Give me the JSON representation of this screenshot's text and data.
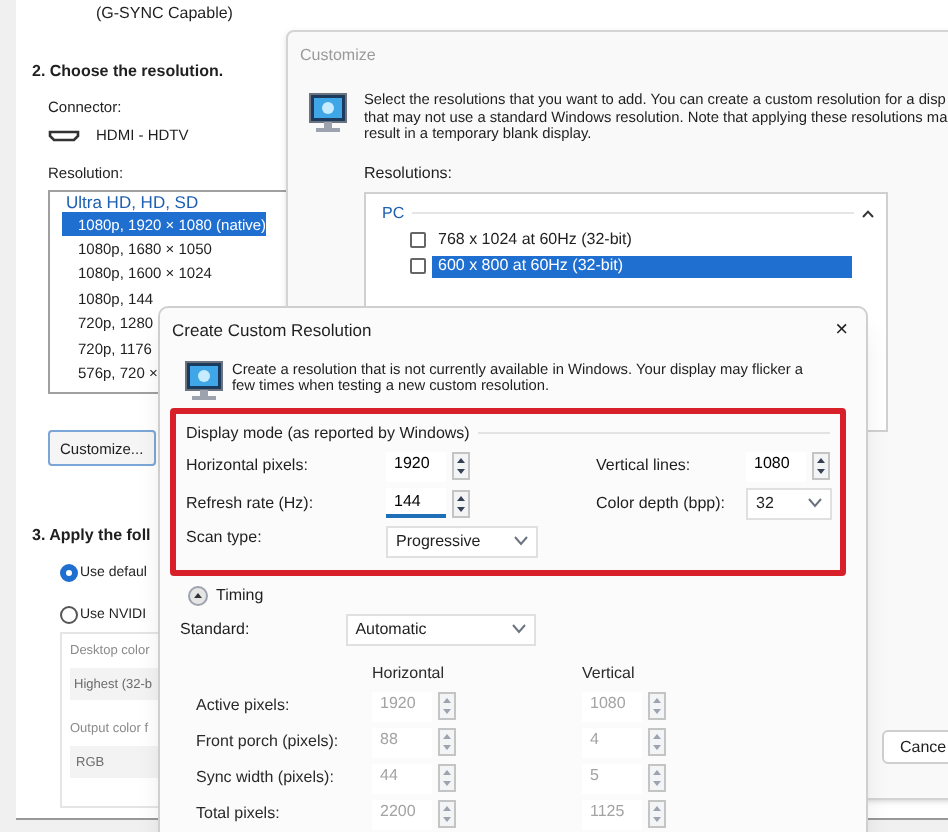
{
  "nvidia_panel": {
    "top_text": "(G-SYNC Capable)",
    "step2": "2. Choose the resolution.",
    "connector_label": "Connector:",
    "connector": "HDMI - HDTV",
    "resolution_label": "Resolution:",
    "resolution_group": "Ultra HD, HD, SD",
    "resolutions": [
      {
        "label": "1080p, 1920 × 1080 (native)",
        "selected": true
      },
      {
        "label": "1080p, 1680 × 1050",
        "selected": false
      },
      {
        "label": "1080p, 1600 × 1024",
        "selected": false
      },
      {
        "label": "1080p, 144",
        "selected": false
      },
      {
        "label": "720p, 1280",
        "selected": false
      },
      {
        "label": "720p, 1176",
        "selected": false
      },
      {
        "label": "576p, 720 ×",
        "selected": false
      }
    ],
    "customize_button": "Customize...",
    "step3": "3. Apply the foll",
    "options": [
      {
        "label": "Use defaul",
        "selected": true
      },
      {
        "label": "Use NVIDI",
        "selected": false
      }
    ],
    "desktop_color_label": "Desktop color",
    "desktop_color": "Highest (32-b",
    "output_color_label": "Output color f",
    "output_color": "RGB"
  },
  "customize_window": {
    "title": "Customize",
    "description": [
      "Select the resolutions that you want to add. You can create a custom resolution for a disp",
      "that may not use a standard Windows resolution. Note that applying these resolutions ma",
      "result in a temporary blank display."
    ],
    "resolutions_label": "Resolutions:",
    "group": "PC",
    "items": [
      {
        "label": "768 x 1024 at 60Hz (32-bit)",
        "checked": false,
        "selected": false
      },
      {
        "label": "600 x 800 at 60Hz (32-bit)",
        "checked": false,
        "selected": true
      }
    ],
    "cancel_button": "Cance"
  },
  "custom_resolution_dialog": {
    "title": "Create Custom Resolution",
    "close": "×",
    "description": [
      "Create a resolution that is not currently available in Windows. Your display may flicker a",
      "few times when testing a new custom resolution."
    ],
    "display_mode": {
      "title": "Display mode (as reported by Windows)",
      "horizontal_pixels": {
        "label": "Horizontal pixels:",
        "value": "1920"
      },
      "vertical_lines": {
        "label": "Vertical lines:",
        "value": "1080"
      },
      "refresh_rate": {
        "label": "Refresh rate (Hz):",
        "value": "144"
      },
      "color_depth": {
        "label": "Color depth (bpp):",
        "value": "32"
      },
      "scan_type": {
        "label": "Scan type:",
        "value": "Progressive"
      }
    },
    "timing": {
      "label": "Timing",
      "expanded": true,
      "standard_label": "Standard:",
      "standard": "Automatic",
      "columns": [
        "Horizontal",
        "Vertical"
      ],
      "rows": [
        {
          "label": "Active pixels:",
          "horizontal": "1920",
          "vertical": "1080"
        },
        {
          "label": "Front porch (pixels):",
          "horizontal": "88",
          "vertical": "4"
        },
        {
          "label": "Sync width (pixels):",
          "horizontal": "44",
          "vertical": "5"
        },
        {
          "label": "Total pixels:",
          "horizontal": "2200",
          "vertical": "1125"
        }
      ]
    }
  }
}
